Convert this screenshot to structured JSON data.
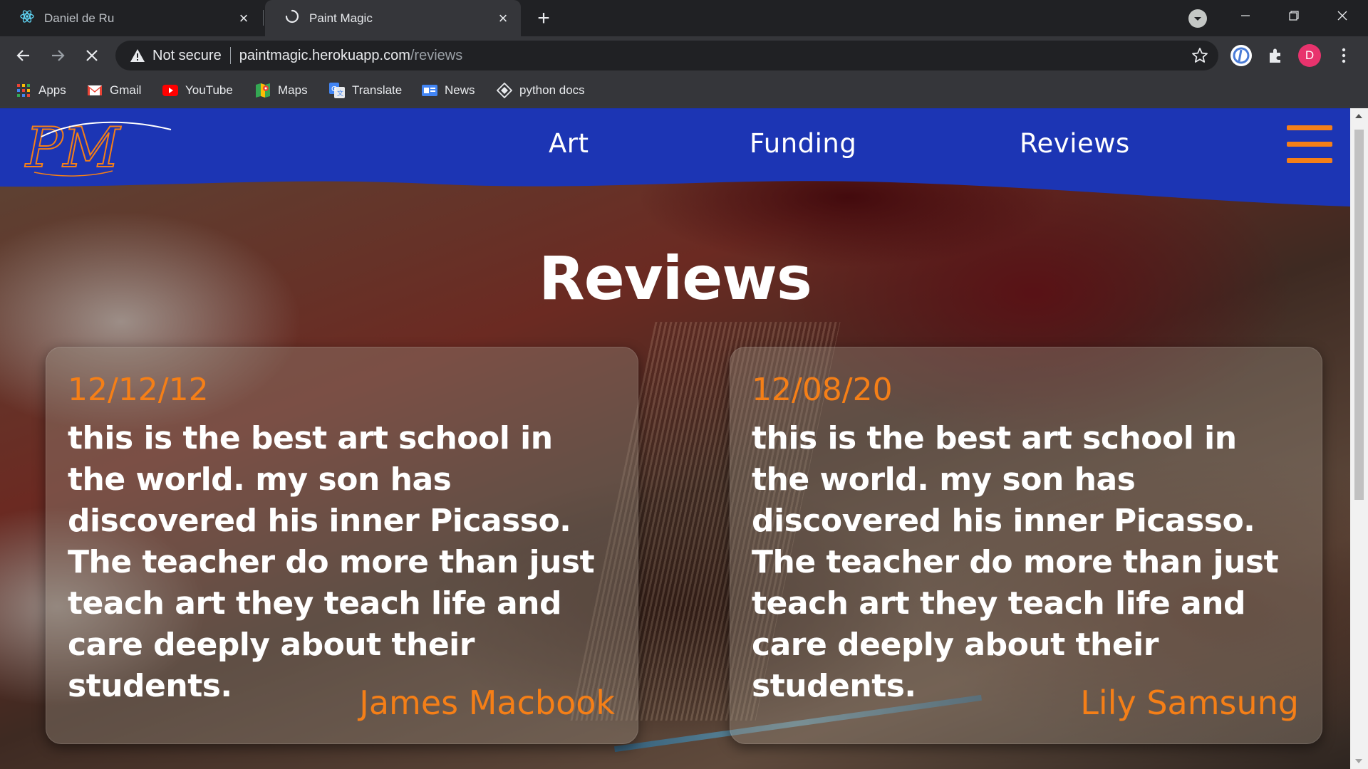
{
  "browser": {
    "tabs": [
      {
        "title": "Daniel de Ru",
        "icon": "react-atom-icon",
        "active": false
      },
      {
        "title": "Paint Magic",
        "icon": "loading-spinner-icon",
        "active": true
      }
    ],
    "address": {
      "security_label": "Not secure",
      "host": "paintmagic.herokuapp.com",
      "path": "/reviews"
    },
    "bookmarks": [
      {
        "label": "Apps",
        "icon": "apps-grid-icon"
      },
      {
        "label": "Gmail",
        "icon": "gmail-icon"
      },
      {
        "label": "YouTube",
        "icon": "youtube-icon"
      },
      {
        "label": "Maps",
        "icon": "maps-icon"
      },
      {
        "label": "Translate",
        "icon": "translate-icon"
      },
      {
        "label": "News",
        "icon": "news-icon"
      },
      {
        "label": "python docs",
        "icon": "python-docs-icon"
      }
    ],
    "profile_initial": "D"
  },
  "site": {
    "logo_text": "PM",
    "nav": [
      {
        "label": "Art"
      },
      {
        "label": "Funding"
      },
      {
        "label": "Reviews"
      }
    ],
    "heading": "Reviews",
    "reviews": [
      {
        "date": "12/12/12",
        "text": "this is the best art school in the world. my son has discovered his inner Picasso. The teacher do more than just teach art they teach life and care deeply about their students.",
        "author": "James Macbook"
      },
      {
        "date": "12/08/20",
        "text": "this is the best art school in the world. my son has discovered his inner Picasso. The teacher do more than just teach art they teach life and care deeply about their students.",
        "author": "Lily Samsung"
      }
    ]
  },
  "colors": {
    "navbar": "#1c35b4",
    "accent": "#f57f17",
    "chrome_dark": "#202124",
    "chrome_toolbar": "#35363a"
  }
}
